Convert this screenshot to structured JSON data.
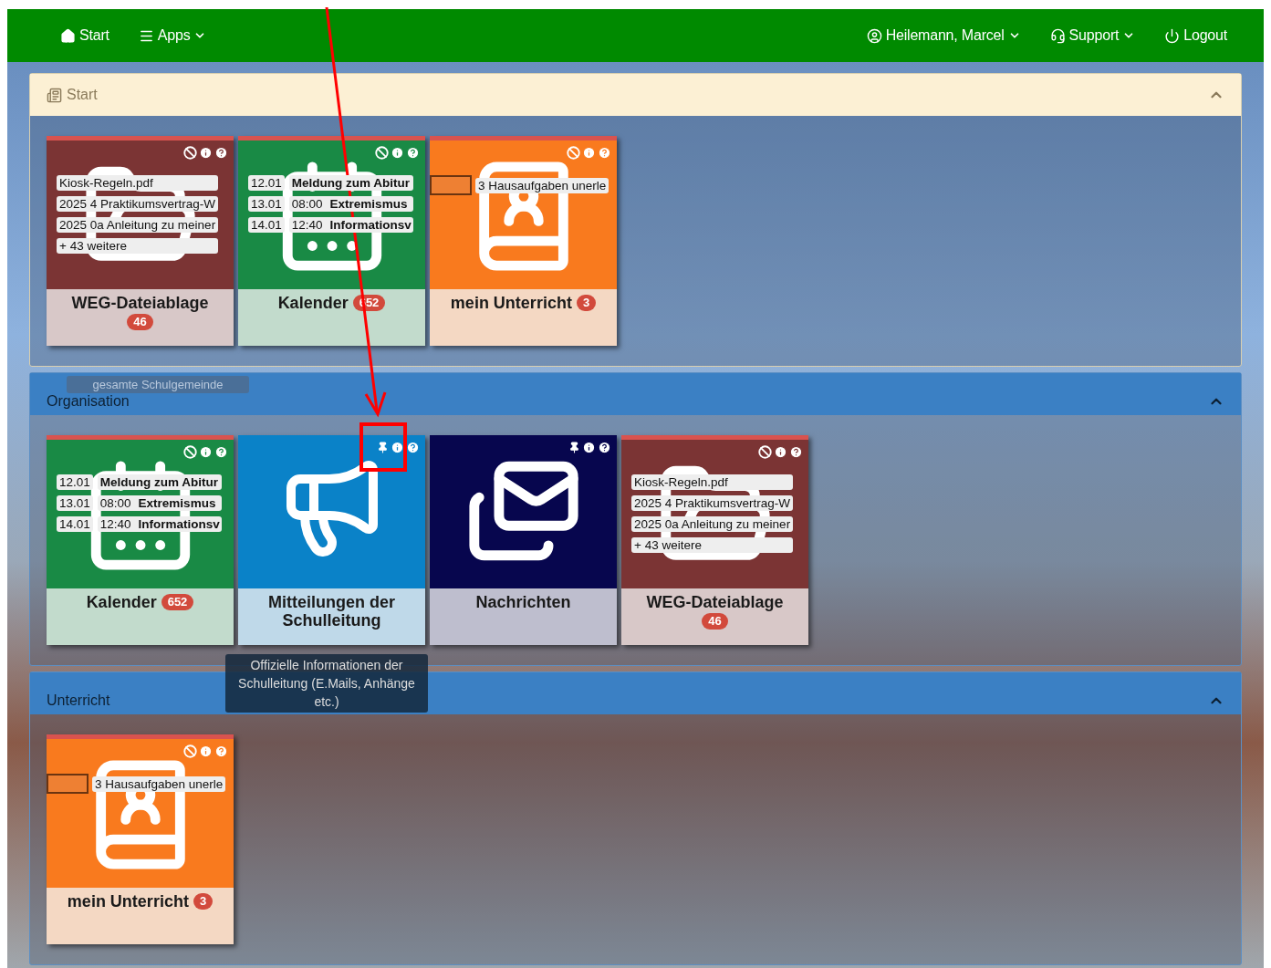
{
  "navbar": {
    "left": [
      {
        "kind": "home",
        "label": "Start",
        "dropdown": false
      },
      {
        "kind": "menu",
        "label": "Apps",
        "dropdown": true
      }
    ],
    "right": [
      {
        "kind": "user",
        "label": "Heilemann, Marcel",
        "dropdown": true
      },
      {
        "kind": "support",
        "label": "Support",
        "dropdown": true
      },
      {
        "kind": "power",
        "label": "Logout",
        "dropdown": false
      }
    ]
  },
  "sections": [
    {
      "title": "Start",
      "kind": "start",
      "expanded": true,
      "tiles": [
        {
          "title": "WEG-Dateiablage",
          "badge": "46",
          "kind": "files",
          "color": "#7b3434",
          "alert": true,
          "pinned": false,
          "highlighted": false,
          "preview": [
            "Kiosk-Regeln.pdf",
            "2025 4 Praktikumsvertrag-W",
            "2025 0a Anleitung zu meiner",
            "+ 43 weitere"
          ]
        },
        {
          "title": "Kalender",
          "badge": "652",
          "kind": "calendar",
          "color": "#198a45",
          "alert": true,
          "pinned": false,
          "highlighted": false,
          "events": [
            {
              "date": "12.01",
              "title": "Meldung zum Abitur"
            },
            {
              "date": "13.01",
              "time": "08:00",
              "title": "Extremismus"
            },
            {
              "date": "14.01",
              "time": "12:40",
              "title": "Informationsv"
            }
          ]
        },
        {
          "title": "mein Unterricht",
          "badge": "3",
          "kind": "homework",
          "color": "#f97a1e",
          "alert": true,
          "pinned": false,
          "highlighted": false,
          "preview": [
            "3 Hausaufgaben unerle"
          ]
        }
      ]
    },
    {
      "title": "Organisation",
      "kind": "blue",
      "expanded": true,
      "ghost_tooltip": "gesamte Schulgemeinde",
      "tiles": [
        {
          "title": "Kalender",
          "badge": "652",
          "kind": "calendar",
          "color": "#198a45",
          "alert": true,
          "pinned": false,
          "highlighted": false,
          "events": [
            {
              "date": "12.01",
              "title": "Meldung zum Abitur"
            },
            {
              "date": "13.01",
              "time": "08:00",
              "title": "Extremismus"
            },
            {
              "date": "14.01",
              "time": "12:40",
              "title": "Informationsv"
            }
          ]
        },
        {
          "title": "Mitteilungen der Schulleitung",
          "kind": "megaphone",
          "color": "#0a82c8",
          "alert": false,
          "pinned": true,
          "highlighted": true,
          "tooltip": "Offizielle Informationen der Schulleitung (E.Mails, Anhänge etc.)"
        },
        {
          "title": "Nachrichten",
          "kind": "messages",
          "color": "#07064e",
          "alert": false,
          "pinned": true,
          "highlighted": false
        },
        {
          "title": "WEG-Dateiablage",
          "badge": "46",
          "kind": "files",
          "color": "#7b3434",
          "alert": true,
          "pinned": false,
          "highlighted": false,
          "preview": [
            "Kiosk-Regeln.pdf",
            "2025 4 Praktikumsvertrag-W",
            "2025 0a Anleitung zu meiner",
            "+ 43 weitere"
          ]
        }
      ]
    },
    {
      "title": "Unterricht",
      "kind": "blue",
      "expanded": true,
      "tiles": [
        {
          "title": "mein Unterricht",
          "badge": "3",
          "kind": "homework",
          "color": "#f97a1e",
          "alert": true,
          "pinned": false,
          "highlighted": false,
          "preview": [
            "3 Hausaufgaben unerle"
          ]
        }
      ]
    }
  ]
}
